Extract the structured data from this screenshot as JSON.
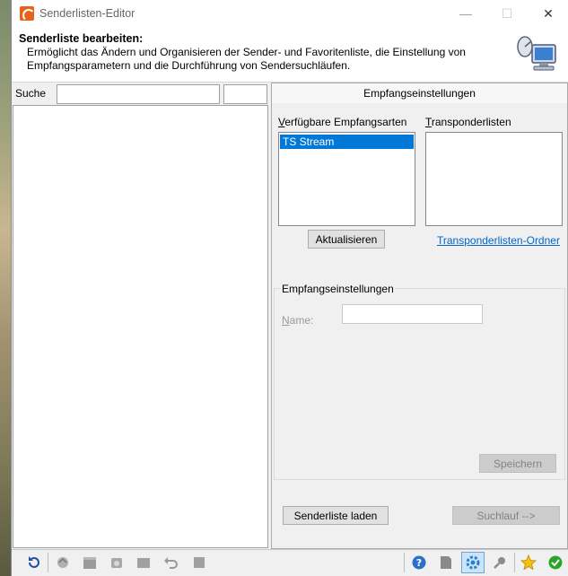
{
  "window": {
    "title": "Senderlisten-Editor",
    "minimize": "—",
    "maximize": "☐",
    "close": "✕"
  },
  "header": {
    "title": "Senderliste bearbeiten:",
    "description": "Ermöglicht das Ändern und Organisieren der Sender- und Favoritenliste, die Einstellung von Empfangsparametern und die Durchführung von Sendersuchläufen."
  },
  "left": {
    "search_label": "Suche",
    "search_value": "",
    "search_value2": ""
  },
  "right": {
    "tab_label": "Empfangseinstellungen",
    "reception_types_label": "Verfügbare Empfangsarten",
    "reception_types_accesskey": "V",
    "reception_types": [
      "TS Stream"
    ],
    "transponder_label": "Transponderlisten",
    "transponder_accesskey": "T",
    "update_button": "Aktualisieren",
    "transponder_folder_link": "Transponderlisten-Ordner",
    "group_title": "Empfangseinstellungen",
    "name_label": "Name:",
    "name_value": "",
    "save_button": "Speichern",
    "load_button": "Senderliste laden",
    "scan_button": "Suchlauf -->"
  },
  "colors": {
    "selection": "#0078d7",
    "link": "#0066cc",
    "accent_orange": "#e8621a"
  }
}
